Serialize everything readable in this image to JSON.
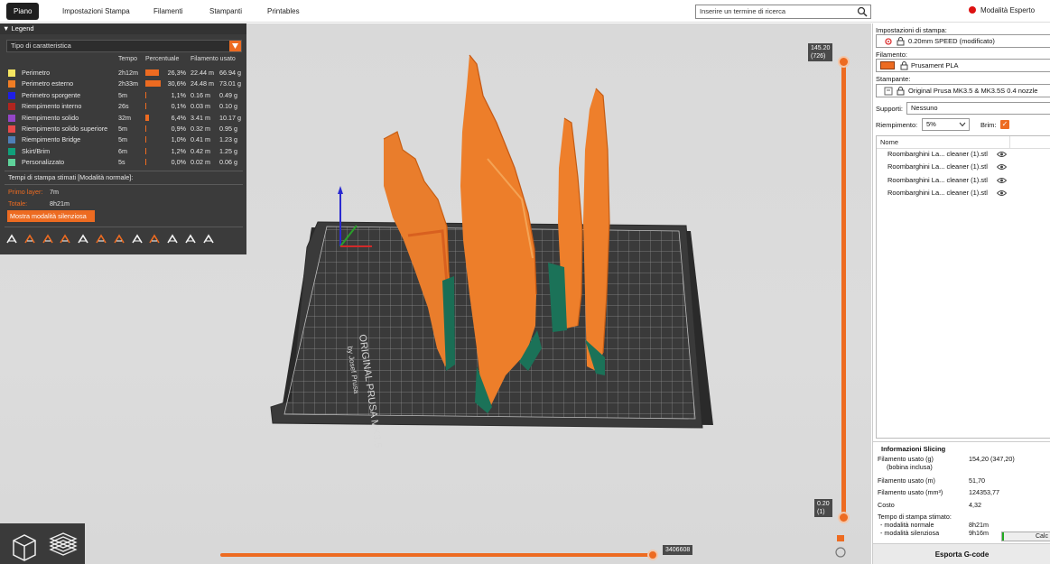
{
  "tabs": [
    {
      "label": "Piano",
      "active": true
    },
    {
      "label": "Impostazioni Stampa",
      "active": false
    },
    {
      "label": "Filamenti",
      "active": false
    },
    {
      "label": "Stampanti",
      "active": false
    },
    {
      "label": "Printables",
      "active": false
    }
  ],
  "search": {
    "placeholder": "Inserire un termine di ricerca",
    "icon": "search-icon"
  },
  "mode": {
    "label": "Modalità Esperto",
    "color": "#d11111"
  },
  "legend": {
    "header": "Legend",
    "view_type": "Tipo di caratteristica",
    "columns": {
      "time": "Tempo",
      "percent": "Percentuale",
      "filament": "Filamento usato"
    },
    "rows": [
      {
        "name": "Perimetro",
        "color": "#f5e561",
        "time": "2h12m",
        "percent": "26,3%",
        "pct_value": 26.3,
        "meters": "22.44 m",
        "grams": "66.94 g"
      },
      {
        "name": "Perimetro esterno",
        "color": "#f07d24",
        "time": "2h33m",
        "percent": "30,6%",
        "pct_value": 30.6,
        "meters": "24.48 m",
        "grams": "73.01 g"
      },
      {
        "name": "Perimetro sporgente",
        "color": "#1f1fe6",
        "time": "5m",
        "percent": "1,1%",
        "pct_value": 1.1,
        "meters": "0.16 m",
        "grams": "0.49 g"
      },
      {
        "name": "Riempimento interno",
        "color": "#b0251f",
        "time": "26s",
        "percent": "0,1%",
        "pct_value": 0.1,
        "meters": "0.03 m",
        "grams": "0.10 g"
      },
      {
        "name": "Riempimento solido",
        "color": "#9446c6",
        "time": "32m",
        "percent": "6,4%",
        "pct_value": 6.4,
        "meters": "3.41 m",
        "grams": "10.17 g"
      },
      {
        "name": "Riempimento solido superiore",
        "color": "#e84a4a",
        "time": "5m",
        "percent": "0,9%",
        "pct_value": 0.9,
        "meters": "0.32 m",
        "grams": "0.95 g"
      },
      {
        "name": "Riempimento Bridge",
        "color": "#4f7fb8",
        "time": "5m",
        "percent": "1,0%",
        "pct_value": 1.0,
        "meters": "0.41 m",
        "grams": "1.23 g"
      },
      {
        "name": "Skirt/Brim",
        "color": "#10a07a",
        "time": "6m",
        "percent": "1,2%",
        "pct_value": 1.2,
        "meters": "0.42 m",
        "grams": "1.25 g"
      },
      {
        "name": "Personalizzato",
        "color": "#5fd29a",
        "time": "5s",
        "percent": "0,0%",
        "pct_value": 0.0,
        "meters": "0.02 m",
        "grams": "0.06 g"
      }
    ],
    "estimated_label": "Tempi di stampa stimati [Modalità normale]:",
    "first_layer_label": "Primo layer:",
    "first_layer_value": "7m",
    "total_label": "Totale:",
    "total_value": "8h21m",
    "silent_button": "Mostra modalità silenziosa",
    "icons": [
      "travel-icon",
      "wipe-icon",
      "retraction-icon",
      "deretraction-icon",
      "seams-icon",
      "toolchange-icon",
      "color-change-icon",
      "pause-icon",
      "custom-gcode-icon",
      "center-of-gravity-icon",
      "shells-icon",
      "tool-marker-icon"
    ]
  },
  "vertical_slider": {
    "top_value": "145.20",
    "top_layer": "(726)",
    "bottom_value": "0.20",
    "bottom_layer": "(1)"
  },
  "horizontal_slider": {
    "value": "3406608"
  },
  "right_panel": {
    "print_settings_label": "Impostazioni di stampa:",
    "print_settings_value": "0.20mm SPEED (modificato)",
    "filament_label": "Filamento:",
    "filament_value": "Prusament PLA",
    "filament_color": "#ed6b21",
    "printer_label": "Stampante:",
    "printer_value": "Original Prusa MK3.5 & MK3.5S 0.4 nozzle",
    "supports_label": "Supporti:",
    "supports_value": "Nessuno",
    "infill_label": "Riempimento:",
    "infill_value": "5%",
    "brim_label": "Brim:",
    "brim_checked": true,
    "objects_header": "Nome",
    "objects": [
      "Roombarghini La... cleaner (1).stl",
      "Roombarghini La... cleaner (1).stl",
      "Roombarghini La... cleaner (1).stl",
      "Roombarghini La... cleaner (1).stl"
    ],
    "slicing_info": {
      "title": "Informazioni Slicing",
      "filament_g_label": "Filamento usato (g)",
      "filament_g_sub": "(bobina inclusa)",
      "filament_g_value": "154,20 (347,20)",
      "filament_m_label": "Filamento usato (m)",
      "filament_m_value": "51,70",
      "filament_mm3_label": "Filamento usato (mm³)",
      "filament_mm3_value": "124353,77",
      "cost_label": "Costo",
      "cost_value": "4,32",
      "est_time_label": "Tempo di stampa stimato:",
      "normal_label": "- modalità normale",
      "normal_value": "8h21m",
      "silent_label": "- modalità silenziosa",
      "silent_value": "9h16m",
      "calc_label": "Calc"
    },
    "export_button": "Esporta G-code"
  },
  "bed": {
    "brand_line1": "ORIGINAL PRUSA MK3.5",
    "brand_line2": "by Josef Prusa"
  }
}
